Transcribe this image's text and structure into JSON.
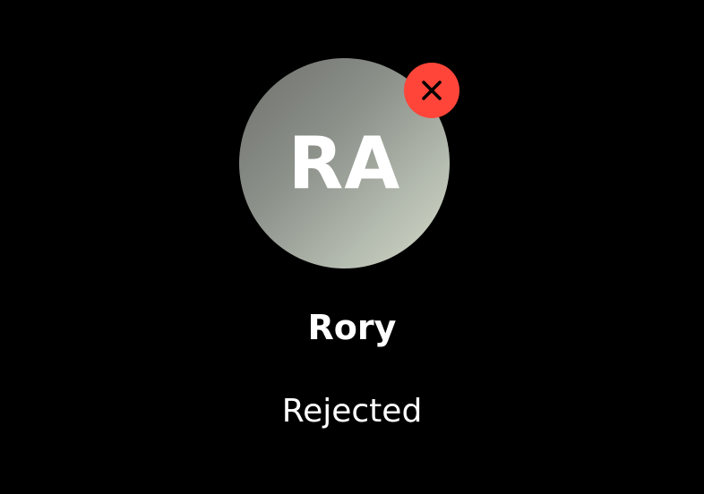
{
  "contact": {
    "initials": "RA",
    "name": "Rory",
    "status": "Rejected",
    "status_icon": "close-icon"
  },
  "colors": {
    "background": "#000000",
    "badge": "#ff453a",
    "text": "#ffffff"
  }
}
